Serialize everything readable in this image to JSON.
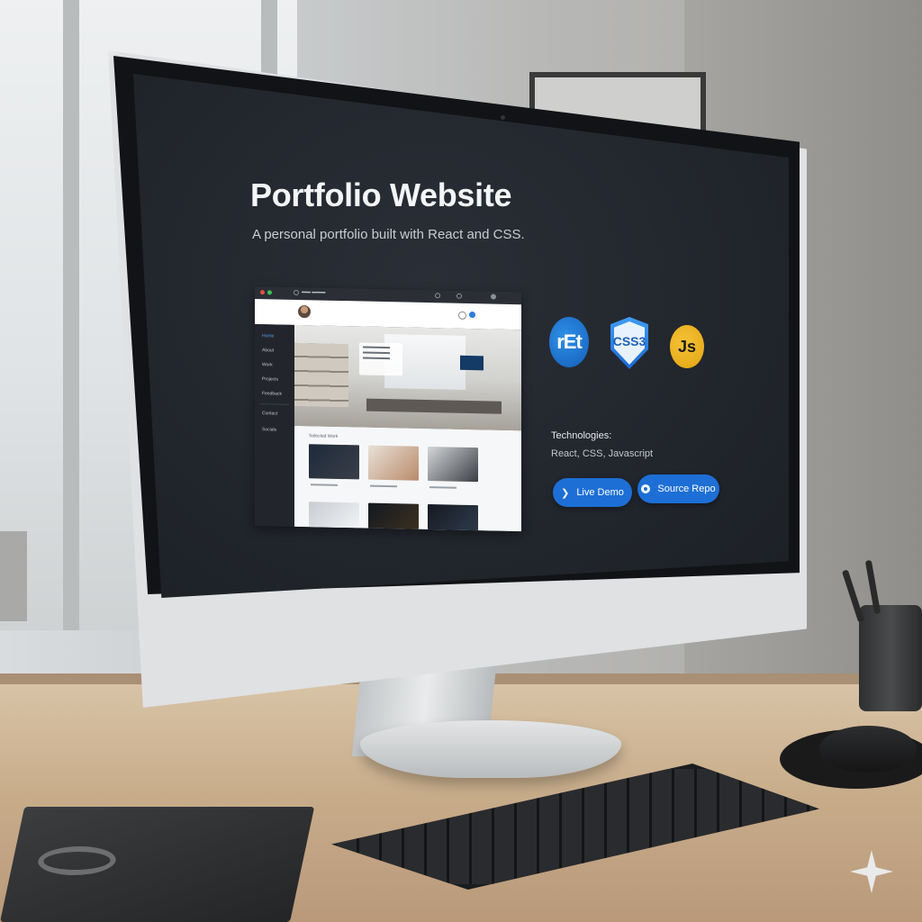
{
  "page": {
    "title": "Portfolio Website",
    "subtitle": "A personal portfolio built with React and CSS."
  },
  "preview": {
    "sidebar": [
      {
        "label": "Home",
        "active": true
      },
      {
        "label": "About",
        "active": false
      },
      {
        "label": "Work",
        "active": false
      },
      {
        "label": "Projects",
        "active": false
      },
      {
        "label": "Feedback",
        "active": false
      }
    ],
    "sidebar_footer": [
      "Contact",
      "Socials"
    ],
    "section_title": "Selected Work"
  },
  "tech_icons": [
    {
      "name": "react-icon",
      "label": "rEt"
    },
    {
      "name": "css3-icon",
      "label": "CSS3"
    },
    {
      "name": "javascript-icon",
      "label": "Js"
    }
  ],
  "technologies": {
    "heading": "Technologies:",
    "list": "React, CSS, Javascript"
  },
  "buttons": {
    "demo_label": "Live Demo",
    "repo_label": "Source Repo"
  },
  "colors": {
    "accent": "#1d6fd6",
    "screen_bg": "#22262d",
    "react": "#2f8fe8",
    "css": "#3f9cf5",
    "javascript": "#f6c237"
  }
}
